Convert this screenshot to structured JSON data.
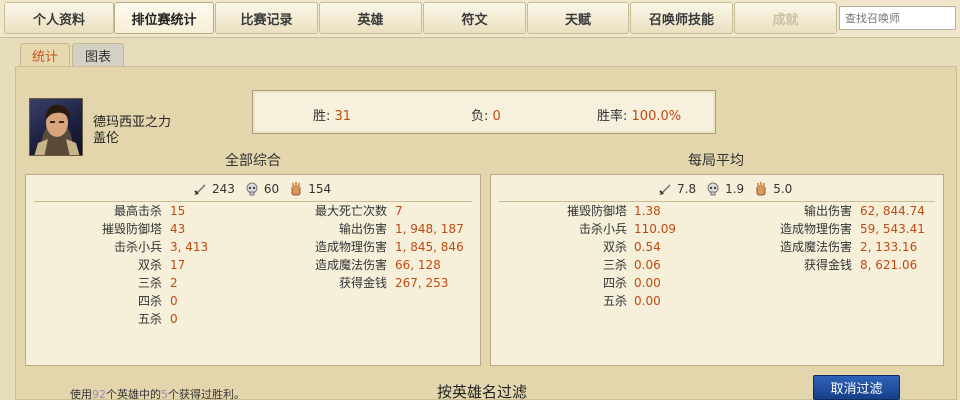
{
  "nav": {
    "tabs": [
      {
        "label": "个人资料"
      },
      {
        "label": "排位赛统计"
      },
      {
        "label": "比赛记录"
      },
      {
        "label": "英雄"
      },
      {
        "label": "符文"
      },
      {
        "label": "天赋"
      },
      {
        "label": "召唤师技能"
      },
      {
        "label": "成就"
      }
    ],
    "search_placeholder": "查找召唤师"
  },
  "subtabs": [
    {
      "label": "统计"
    },
    {
      "label": "图表"
    }
  ],
  "champion": {
    "title": "德玛西亚之力",
    "name": "盖伦"
  },
  "record": {
    "win_label": "胜:",
    "win_value": "31",
    "loss_label": "负:",
    "loss_value": "0",
    "rate_label": "胜率:",
    "rate_value": "100.0%"
  },
  "totals": {
    "title": "全部综合",
    "icons": [
      {
        "icon": "sword-icon",
        "value": "243"
      },
      {
        "icon": "skull-icon",
        "value": "60"
      },
      {
        "icon": "hand-icon",
        "value": "154"
      }
    ],
    "left": [
      {
        "label": "最高击杀",
        "value": "15"
      },
      {
        "label": "摧毁防御塔",
        "value": "43"
      },
      {
        "label": "击杀小兵",
        "value": "3, 413"
      },
      {
        "label": "双杀",
        "value": "17"
      },
      {
        "label": "三杀",
        "value": "2"
      },
      {
        "label": "四杀",
        "value": "0"
      },
      {
        "label": "五杀",
        "value": "0"
      }
    ],
    "right": [
      {
        "label": "最大死亡次数",
        "value": "7"
      },
      {
        "label": "输出伤害",
        "value": "1, 948, 187"
      },
      {
        "label": "造成物理伤害",
        "value": "1, 845, 846"
      },
      {
        "label": "造成魔法伤害",
        "value": "66, 128"
      },
      {
        "label": "获得金钱",
        "value": "267, 253"
      }
    ]
  },
  "average": {
    "title": "每局平均",
    "icons": [
      {
        "icon": "sword-icon",
        "value": "7.8"
      },
      {
        "icon": "skull-icon",
        "value": "1.9"
      },
      {
        "icon": "hand-icon",
        "value": "5.0"
      }
    ],
    "left": [
      {
        "label": "摧毁防御塔",
        "value": "1.38"
      },
      {
        "label": "击杀小兵",
        "value": "110.09"
      },
      {
        "label": "双杀",
        "value": "0.54"
      },
      {
        "label": "三杀",
        "value": "0.06"
      },
      {
        "label": "四杀",
        "value": "0.00"
      },
      {
        "label": "五杀",
        "value": "0.00"
      }
    ],
    "right": [
      {
        "label": "输出伤害",
        "value": "62, 844.74"
      },
      {
        "label": "造成物理伤害",
        "value": "59, 543.41"
      },
      {
        "label": "造成魔法伤害",
        "value": "2, 133.16"
      },
      {
        "label": "获得金钱",
        "value": "8, 621.06"
      }
    ]
  },
  "footer": {
    "prefix": "使用",
    "used_count": "92",
    "middle": "个英雄中的",
    "won_count": "5",
    "suffix": "个获得过胜利。",
    "filter_title": "按英雄名过滤",
    "cancel_label": "取消过滤"
  },
  "colors": {
    "value": "#c04a14",
    "button": "#1f4d9e",
    "background": "#e3d6ac"
  }
}
